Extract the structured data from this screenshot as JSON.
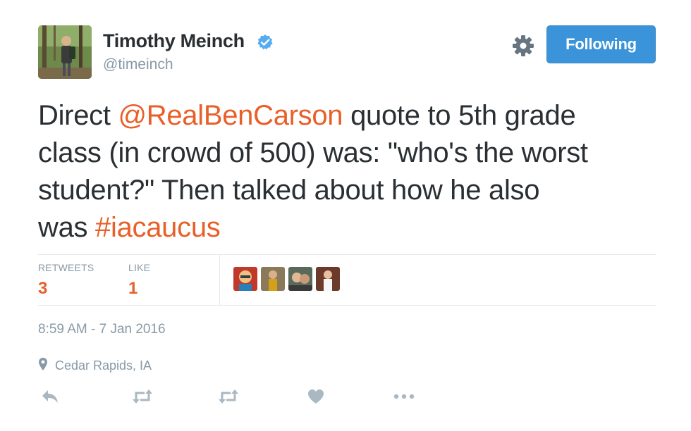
{
  "user": {
    "name": "Timothy Meinch",
    "handle": "@timeinch",
    "verified": true,
    "avatar_icon": "profile-photo"
  },
  "header": {
    "follow_label": "Following",
    "settings_icon": "gear-icon"
  },
  "tweet": {
    "lines": [
      [
        {
          "text": "Direct ",
          "type": "plain"
        },
        {
          "text": "@RealBenCarson",
          "type": "mention"
        },
        {
          "text": " quote to 5th grade",
          "type": "plain"
        }
      ],
      [
        {
          "text": "class (in crowd of 500) was: \"who's the worst",
          "type": "plain"
        }
      ],
      [
        {
          "text": "student?\" Then talked about how he also",
          "type": "plain"
        }
      ],
      [
        {
          "text": "was ",
          "type": "plain"
        },
        {
          "text": "#iacaucus",
          "type": "hashtag"
        }
      ]
    ]
  },
  "stats": {
    "retweets_label": "RETWEETS",
    "retweets_value": "3",
    "likes_label": "LIKE",
    "likes_value": "1"
  },
  "likers": [
    "liker-avatar",
    "liker-avatar",
    "liker-avatar",
    "liker-avatar"
  ],
  "meta": {
    "timestamp": "8:59 AM - 7 Jan 2016",
    "location": "Cedar Rapids, IA"
  },
  "actions": [
    "reply-icon",
    "retweet-icon",
    "retweet-icon",
    "like-icon",
    "more-icon"
  ],
  "colors": {
    "accent": "#e95f28",
    "button": "#3b94d9",
    "muted": "#8899a6",
    "text": "#292f33",
    "divider": "#e1e8ed"
  }
}
